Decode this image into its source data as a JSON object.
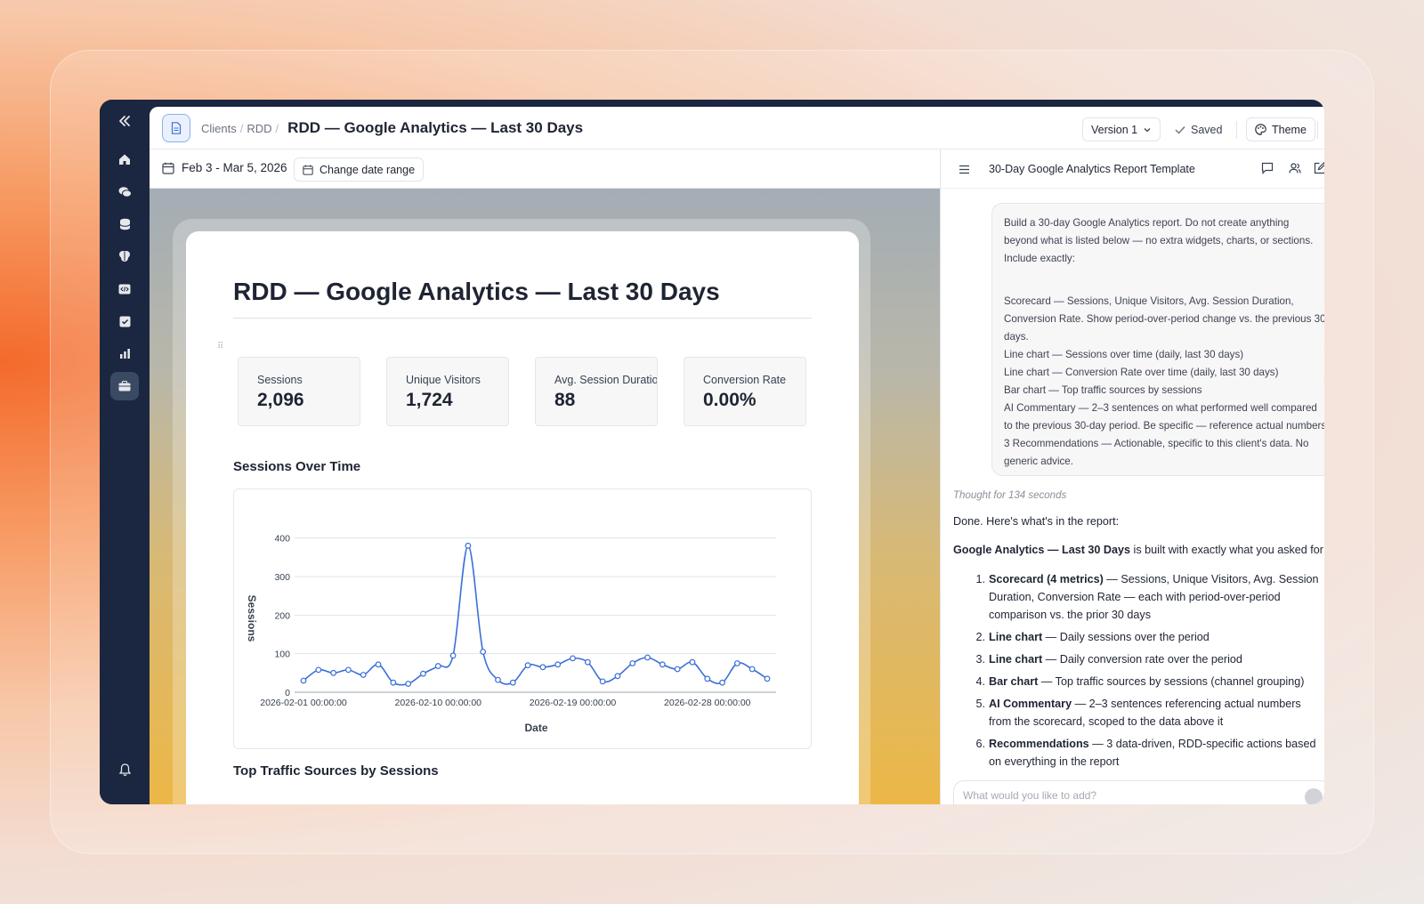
{
  "breadcrumb": {
    "items": [
      "Clients",
      "RDD"
    ],
    "title": "RDD — Google Analytics — Last 30 Days"
  },
  "toolbar": {
    "version_label": "Version 1",
    "saved_label": "Saved",
    "theme_label": "Theme"
  },
  "date_range": {
    "label": "Feb 3 - Mar 5, 2026",
    "change_label": "Change date range"
  },
  "report": {
    "title": "RDD — Google Analytics — Last 30 Days",
    "metrics": [
      {
        "label": "Sessions",
        "value": "2,096"
      },
      {
        "label": "Unique Visitors",
        "value": "1,724"
      },
      {
        "label": "Avg. Session Duration",
        "value": "88"
      },
      {
        "label": "Conversion Rate",
        "value": "0.00%"
      }
    ],
    "sessions_section_title": "Sessions Over Time",
    "traffic_section_title": "Top Traffic Sources by Sessions"
  },
  "chart_data": {
    "type": "line",
    "title": "Sessions Over Time",
    "xlabel": "Date",
    "ylabel": "Sessions",
    "ylim": [
      0,
      420
    ],
    "yticks": [
      "0",
      "100",
      "200",
      "300",
      "400"
    ],
    "xticks": [
      "2026-02-01 00:00:00",
      "2026-02-10 00:00:00",
      "2026-02-19 00:00:00",
      "2026-02-28 00:00:00"
    ],
    "x": [
      "2026-02-01",
      "2026-02-02",
      "2026-02-03",
      "2026-02-04",
      "2026-02-05",
      "2026-02-06",
      "2026-02-07",
      "2026-02-08",
      "2026-02-09",
      "2026-02-10",
      "2026-02-11",
      "2026-02-12",
      "2026-02-13",
      "2026-02-14",
      "2026-02-15",
      "2026-02-16",
      "2026-02-17",
      "2026-02-18",
      "2026-02-19",
      "2026-02-20",
      "2026-02-21",
      "2026-02-22",
      "2026-02-23",
      "2026-02-24",
      "2026-02-25",
      "2026-02-26",
      "2026-02-27",
      "2026-02-28",
      "2026-02-29",
      "2026-03-01",
      "2026-03-02",
      "2026-03-03"
    ],
    "series": [
      {
        "values": [
          30,
          58,
          50,
          58,
          45,
          72,
          25,
          22,
          48,
          68,
          95,
          380,
          105,
          32,
          25,
          70,
          65,
          72,
          88,
          78,
          28,
          42,
          75,
          90,
          72,
          60,
          78,
          35,
          25,
          75,
          60,
          35
        ],
        "color": "#3b6fd8"
      }
    ],
    "grid": true
  },
  "assistant_panel": {
    "title": "30-Day Google Analytics Report Template",
    "prompt_lines": [
      "Build a 30-day Google Analytics report. Do not create anything",
      "beyond what is listed below — no extra widgets, charts, or sections.",
      "Include exactly:",
      "",
      "",
      "Scorecard — Sessions, Unique Visitors, Avg. Session Duration,",
      "Conversion Rate. Show period-over-period change vs. the previous 30",
      "days.",
      "Line chart — Sessions over time (daily, last 30 days)",
      "Line chart — Conversion Rate over time (daily, last 30 days)",
      "Bar chart — Top traffic sources by sessions",
      "AI Commentary — 2–3 sentences on what performed well compared",
      "to the previous 30-day period. Be specific — reference actual numbers.",
      "3 Recommendations — Actionable, specific to this client's data. No",
      "generic advice."
    ],
    "thought": "Thought for 134 seconds",
    "answer_intro": "Done. Here's what's in the report:",
    "answer_lead_bold": "Google Analytics — Last 30 Days",
    "answer_lead_rest": " is built with exactly what you asked for:",
    "items": [
      {
        "num": "1.",
        "bold": "Scorecard (4 metrics)",
        "text": " — Sessions, Unique Visitors, Avg. Session Duration, Conversion Rate — each with period-over-period comparison vs. the prior 30 days"
      },
      {
        "num": "2.",
        "bold": "Line chart",
        "text": " — Daily sessions over the period"
      },
      {
        "num": "3.",
        "bold": "Line chart",
        "text": " — Daily conversion rate over the period"
      },
      {
        "num": "4.",
        "bold": "Bar chart",
        "text": " — Top traffic sources by sessions (channel grouping)"
      },
      {
        "num": "5.",
        "bold": "AI Commentary",
        "text": " — 2–3 sentences referencing actual numbers from the scorecard, scoped to the data above it"
      },
      {
        "num": "6.",
        "bold": "Recommendations",
        "text": " — 3 data-driven, RDD-specific actions based on everything in the report"
      }
    ],
    "input_placeholder": "What would you like to add?"
  },
  "colors": {
    "accent": "#3b6fd8",
    "sidebar": "#1b2740"
  },
  "icons": {
    "sidebar": [
      "collapse-icon",
      "home-icon",
      "chat-icon",
      "database-icon",
      "brain-icon",
      "code-icon",
      "checkbox-icon",
      "bar-chart-icon",
      "briefcase-icon",
      "bell-icon"
    ]
  }
}
